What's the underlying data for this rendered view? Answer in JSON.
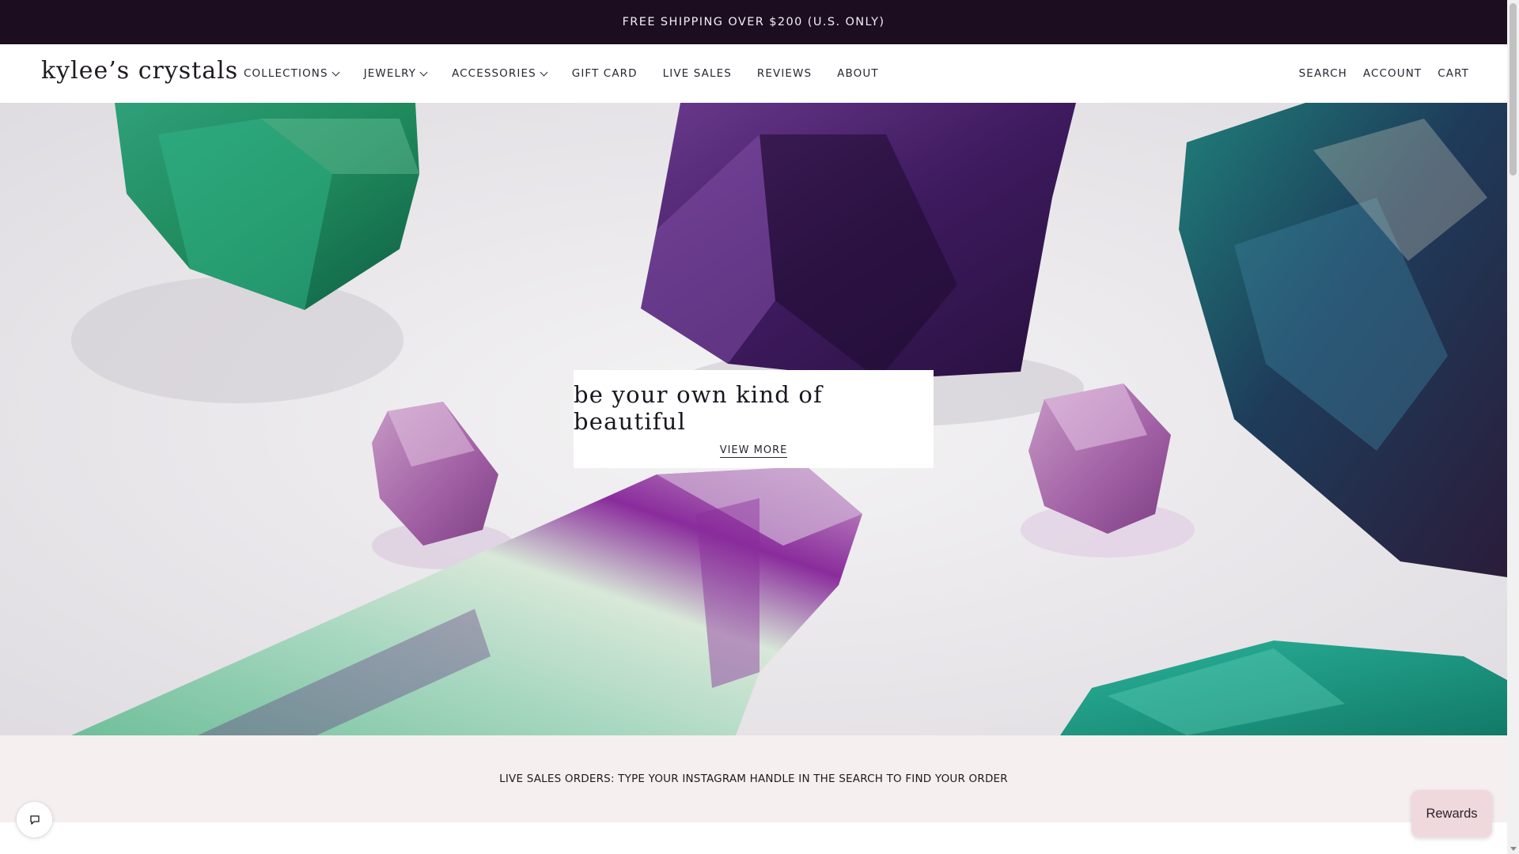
{
  "announcement": {
    "text": "FREE SHIPPING OVER $200 (U.S. ONLY)"
  },
  "header": {
    "logo": "kylee’s crystals",
    "nav": [
      {
        "label": "COLLECTIONS",
        "dropdown": true
      },
      {
        "label": "JEWELRY",
        "dropdown": true
      },
      {
        "label": "ACCESSORIES",
        "dropdown": true
      },
      {
        "label": "GIFT CARD",
        "dropdown": false
      },
      {
        "label": "LIVE SALES",
        "dropdown": false
      },
      {
        "label": "REVIEWS",
        "dropdown": false
      },
      {
        "label": "ABOUT",
        "dropdown": false
      }
    ],
    "utility": {
      "search": "SEARCH",
      "account": "ACCOUNT",
      "cart": "CART"
    }
  },
  "hero": {
    "title": "be your own kind of beautiful",
    "link": "VIEW MORE",
    "image_icon": "crystal-photo"
  },
  "live_sales": {
    "text": "LIVE SALES ORDERS: TYPE YOUR INSTAGRAM HANDLE IN THE SEARCH TO FIND YOUR ORDER"
  },
  "widgets": {
    "rewards_label": "Rewards",
    "chat_icon": "chat-bubble-icon"
  },
  "colors": {
    "announcement_bg": "#1c0d20",
    "live_bar_bg": "#f6efef",
    "rewards_bg": "#efd9dd"
  }
}
